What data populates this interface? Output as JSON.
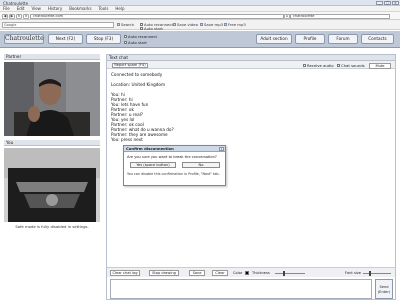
{
  "window": {
    "title": "Chatroulette",
    "minimize": "_",
    "maximize": "□",
    "close": "×"
  },
  "menu": [
    "File",
    "Edit",
    "View",
    "History",
    "Bookmarks",
    "Tools",
    "Help"
  ],
  "browser": {
    "back": "◀",
    "forward": "▶",
    "reload": "↻",
    "stop": "×",
    "home": "⌂",
    "url": "chatroulette.com",
    "search_text": "chatroulette"
  },
  "toolbar": {
    "google_search_placeholder": "Google",
    "search_label": "Search",
    "save_video": "Save video",
    "save_mp3": "Save mp3",
    "free_mp3": "Free mp3",
    "auto_reconnect": "Auto reconnect",
    "auto_start": "Auto start"
  },
  "site": {
    "logo": "Chatroulette",
    "next_button": "Next (F2)",
    "stop_button": "Stop (F3)",
    "adult_section": "Adult section",
    "profile": "Profile",
    "forum": "Forum",
    "contacts": "Contacts"
  },
  "left": {
    "partner_title": "Partner",
    "you_title": "You",
    "safe_mode": "Safe mode is fully disabled in settings."
  },
  "chat": {
    "title": "Text chat",
    "report_button": "Report spam (F4)",
    "receive_audio": "Receive audio",
    "chat_sounds": "Chat sounds",
    "mute_button": "Mute",
    "log": [
      "Connected to somebody",
      "",
      "Location: United Kingdom",
      "",
      "You: hi",
      "Partner: hi",
      "You: lets have fun",
      "Partner: ok",
      "Partner: u real?",
      "You: yes lol",
      "Partner: ok cool",
      "Partner: what do u wanna do?",
      "Partner: they are awesome",
      "You: press next"
    ],
    "controls": {
      "clear": "Clear chat log",
      "stop_drawing": "Stop drawing",
      "save": "Save",
      "clear2": "Clear",
      "color": "Color",
      "thickness": "Thickness",
      "font_size": "Font size"
    },
    "send": {
      "line1": "Send",
      "line2": "(Enter)"
    }
  },
  "dialog": {
    "title": "Confirm disconnection",
    "close": "x",
    "question": "Are you sure you want to break the conversation?",
    "yes": "Yes (space button)",
    "no": "No",
    "note": "You can disable this confirmation in Profile, \"Next\" tab."
  },
  "colors": {
    "header_bg": "#bfc8d6",
    "panel_title_bg": "#dfe3ea",
    "dialog_title_bg": "#cfd8e6"
  }
}
